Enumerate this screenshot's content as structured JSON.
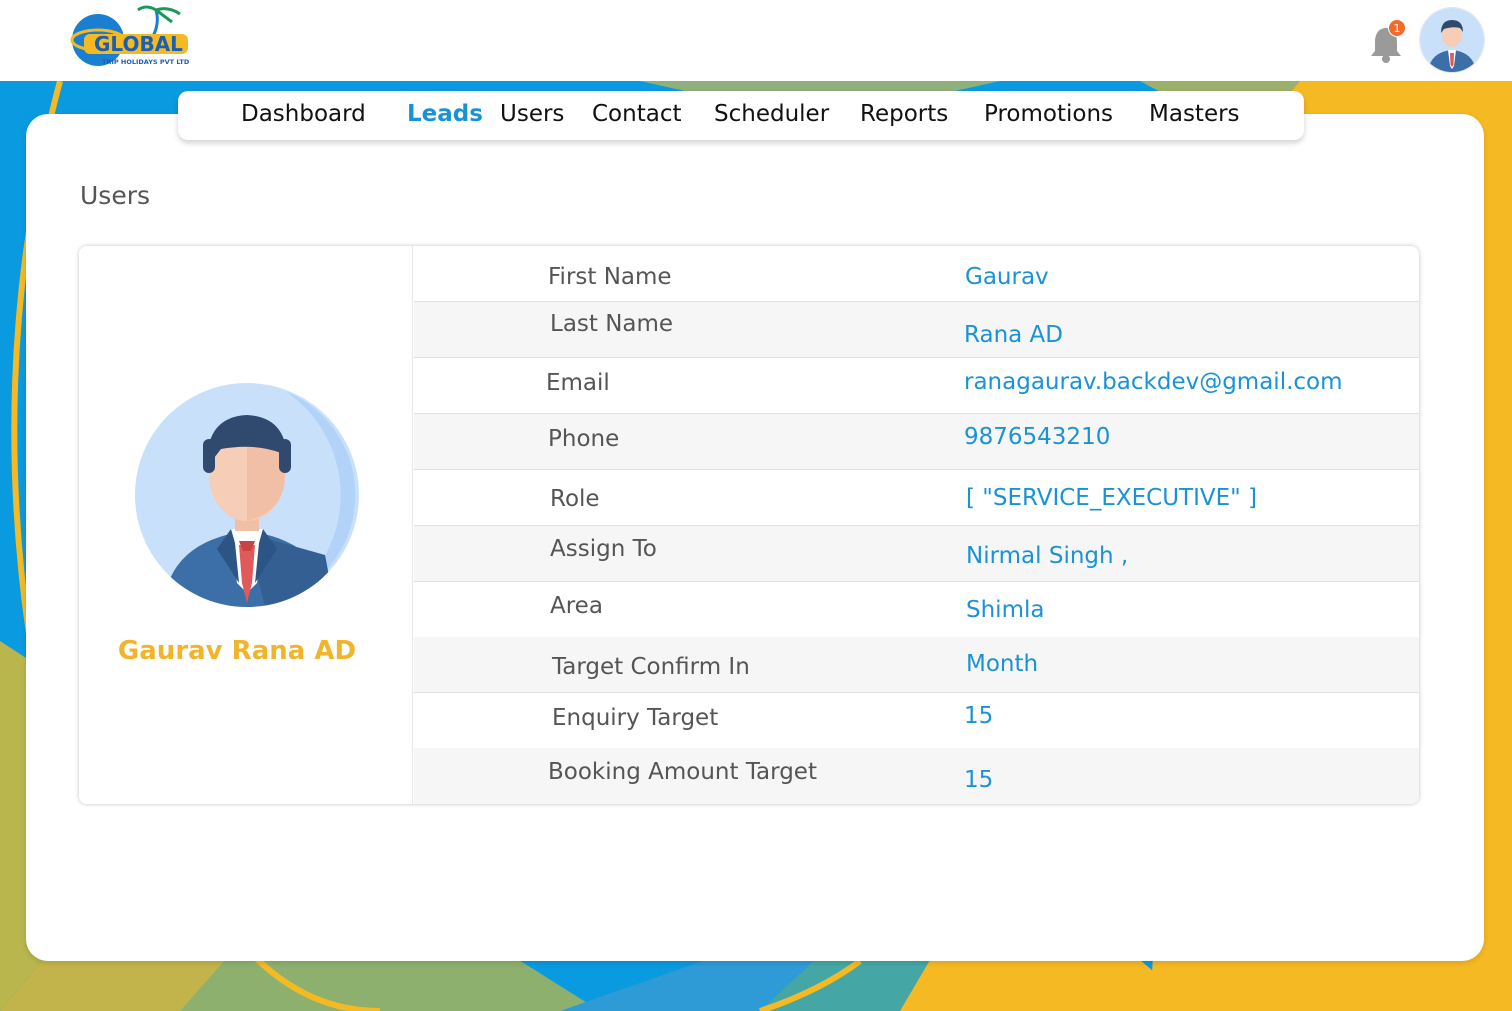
{
  "header": {
    "logo_name": "global-trip-holidays-logo",
    "logo_text": "GLOBAL",
    "logo_subtext": "TRIP HOLIDAYS PVT LTD",
    "notification_count": "1"
  },
  "nav": {
    "items": [
      {
        "label": "Dashboard"
      },
      {
        "label": "Leads"
      },
      {
        "label": "Users"
      },
      {
        "label": "Contact"
      },
      {
        "label": "Scheduler"
      },
      {
        "label": "Reports"
      },
      {
        "label": "Promotions"
      },
      {
        "label": "Masters"
      }
    ],
    "active": "Leads"
  },
  "page": {
    "title": "Users"
  },
  "profile": {
    "name": "Gaurav Rana AD",
    "fields": [
      {
        "label": "First Name",
        "value": "Gaurav"
      },
      {
        "label": "Last Name",
        "value": "Rana AD"
      },
      {
        "label": "Email",
        "value": "ranagaurav.backdev@gmail.com"
      },
      {
        "label": "Phone",
        "value": "9876543210"
      },
      {
        "label": "Role",
        "value": "[ \"SERVICE_EXECUTIVE\" ]"
      },
      {
        "label": "Assign To",
        "value": "Nirmal Singh ,"
      },
      {
        "label": "Area",
        "value": "Shimla"
      },
      {
        "label": "Target Confirm In",
        "value": "Month"
      },
      {
        "label": "Enquiry Target",
        "value": "15"
      },
      {
        "label": "Booking Amount Target",
        "value": "15"
      }
    ]
  },
  "colors": {
    "accent": "#1a93d6",
    "name_color": "#f0b52a",
    "badge": "#f26b2a",
    "bg_blue": "#0a9ae0",
    "bg_yellow": "#f5b923",
    "bg_olive": "#b9b54e",
    "bg_green": "#7fb07a"
  }
}
